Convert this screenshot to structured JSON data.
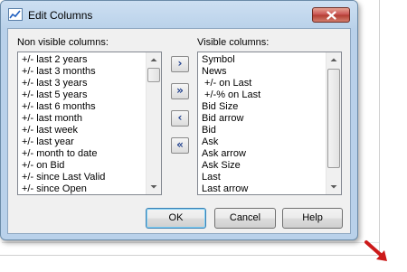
{
  "dialog": {
    "title": "Edit Columns",
    "non_visible_label": "Non visible columns:",
    "visible_label": "Visible columns:",
    "non_visible_columns": [
      "+/- last 2 years",
      "+/- last 3 months",
      "+/- last 3 years",
      "+/- last 5 years",
      "+/- last 6 months",
      "+/- last month",
      "+/- last week",
      "+/- last year",
      "+/- month to date",
      "+/- on Bid",
      "+/- since Last Valid",
      "+/- since Open"
    ],
    "visible_columns": [
      "Symbol",
      "News",
      " +/- on Last",
      " +/-% on Last",
      "Bid Size",
      "Bid arrow",
      "Bid",
      "Ask",
      "Ask arrow",
      "Ask Size",
      "Last",
      "Last arrow"
    ],
    "move_buttons": {
      "add_one": "›",
      "add_all": "»",
      "remove_one": "‹",
      "remove_all": "«"
    },
    "ok_label": "OK",
    "cancel_label": "Cancel",
    "help_label": "Help"
  },
  "icons": {
    "title": "chart-icon",
    "close": "close-icon",
    "resize": "resize-arrow-icon"
  },
  "colors": {
    "titlebar": "#bad2ea",
    "close_button": "#c75050",
    "arrow_glyph": "#1e3e8c",
    "resize_arrow": "#cc1a1a"
  }
}
